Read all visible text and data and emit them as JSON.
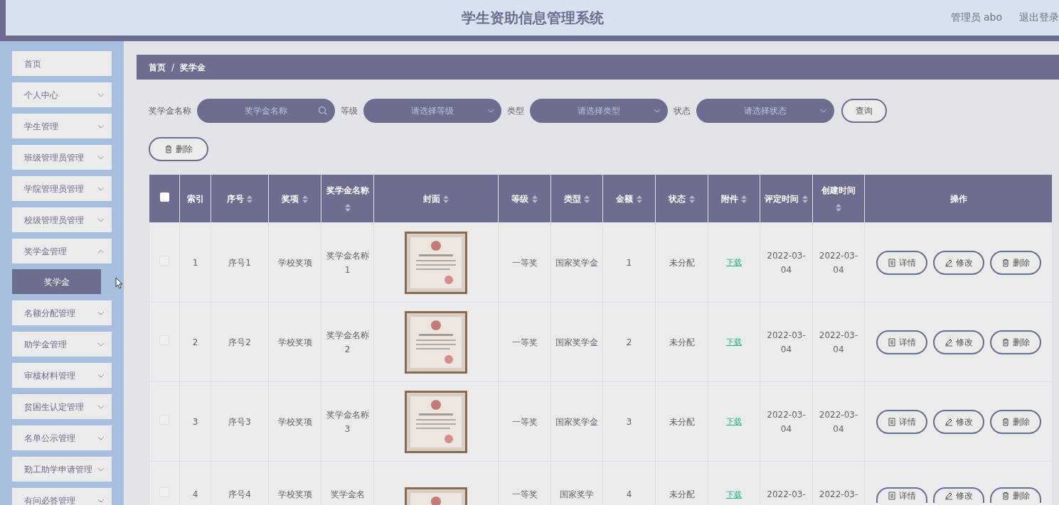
{
  "header": {
    "title": "学生资助信息管理系统",
    "user": "管理员 abo",
    "logout": "退出登录"
  },
  "sidebar": {
    "items": [
      {
        "label": "首页",
        "expandable": false
      },
      {
        "label": "个人中心",
        "expandable": true,
        "expanded": false
      },
      {
        "label": "学生管理",
        "expandable": true,
        "expanded": false
      },
      {
        "label": "班级管理员管理",
        "expandable": true,
        "expanded": false
      },
      {
        "label": "学院管理员管理",
        "expandable": true,
        "expanded": false
      },
      {
        "label": "校级管理员管理",
        "expandable": true,
        "expanded": false
      },
      {
        "label": "奖学金管理",
        "expandable": true,
        "expanded": true,
        "children": [
          {
            "label": "奖学金",
            "selected": true
          }
        ]
      },
      {
        "label": "名额分配管理",
        "expandable": true,
        "expanded": false
      },
      {
        "label": "助学金管理",
        "expandable": true,
        "expanded": false
      },
      {
        "label": "审核材料管理",
        "expandable": true,
        "expanded": false
      },
      {
        "label": "贫困生认定管理",
        "expandable": true,
        "expanded": false
      },
      {
        "label": "名单公示管理",
        "expandable": true,
        "expanded": false
      },
      {
        "label": "勤工助学申请管理",
        "expandable": true,
        "expanded": false
      },
      {
        "label": "有问必答管理",
        "expandable": true,
        "expanded": false
      }
    ]
  },
  "breadcrumb": [
    "首页",
    "/",
    "奖学金"
  ],
  "filters": [
    {
      "label": "奖学金名称",
      "kind": "search",
      "placeholder": "奖学金名称"
    },
    {
      "label": "等级",
      "kind": "select",
      "placeholder": "请选择等级"
    },
    {
      "label": "类型",
      "kind": "select",
      "placeholder": "请选择类型"
    },
    {
      "label": "状态",
      "kind": "select",
      "placeholder": "请选择状态"
    }
  ],
  "query_button": "查询",
  "delete_button": "删除",
  "table": {
    "columns": [
      {
        "kind": "checkbox",
        "checked": false
      },
      {
        "label": "索引",
        "sortable": false
      },
      {
        "label": "序号",
        "sortable": true
      },
      {
        "label": "奖项",
        "sortable": true
      },
      {
        "label": "奖学金名称",
        "sortable": true
      },
      {
        "label": "封面",
        "sortable": true
      },
      {
        "label": "等级",
        "sortable": true
      },
      {
        "label": "类型",
        "sortable": true
      },
      {
        "label": "金额",
        "sortable": true
      },
      {
        "label": "状态",
        "sortable": true
      },
      {
        "label": "附件",
        "sortable": true
      },
      {
        "label": "评定时间",
        "sortable": true
      },
      {
        "label": "创建时间",
        "sortable": true
      },
      {
        "label": "操作",
        "sortable": false
      }
    ],
    "rows": [
      {
        "checked": false,
        "index": "1",
        "number": "序号1",
        "award": "学校奖项",
        "name": "奖学金名称1",
        "cover": {
          "kind": "picture"
        },
        "level": "一等奖",
        "type": "国家奖学金",
        "amount": "1",
        "status": "未分配",
        "attachment": "下载",
        "rated": "2022-03-04",
        "created": "2022-03-04",
        "actions": [
          {
            "kind": "detail",
            "label": "详情"
          },
          {
            "kind": "edit",
            "label": "修改"
          },
          {
            "kind": "delete",
            "label": "删除"
          }
        ]
      },
      {
        "checked": false,
        "index": "2",
        "number": "序号2",
        "award": "学校奖项",
        "name": "奖学金名称2",
        "cover": {
          "kind": "picture"
        },
        "level": "一等奖",
        "type": "国家奖学金",
        "amount": "2",
        "status": "未分配",
        "attachment": "下载",
        "rated": "2022-03-04",
        "created": "2022-03-04",
        "actions": [
          {
            "kind": "detail",
            "label": "详情"
          },
          {
            "kind": "edit",
            "label": "修改"
          },
          {
            "kind": "delete",
            "label": "删除"
          }
        ]
      },
      {
        "checked": false,
        "index": "3",
        "number": "序号3",
        "award": "学校奖项",
        "name": "奖学金名称3",
        "cover": {
          "kind": "picture"
        },
        "level": "一等奖",
        "type": "国家奖学金",
        "amount": "3",
        "status": "未分配",
        "attachment": "下载",
        "rated": "2022-03-04",
        "created": "2022-03-04",
        "actions": [
          {
            "kind": "detail",
            "label": "详情"
          },
          {
            "kind": "edit",
            "label": "修改"
          },
          {
            "kind": "delete",
            "label": "删除"
          }
        ]
      },
      {
        "checked": false,
        "index": "4",
        "number": "序号4",
        "award": "学校奖项",
        "name": "奖学金名",
        "cover": {
          "kind": "picture"
        },
        "level": "一等奖",
        "type": "国家奖学",
        "amount": "4",
        "status": "未分配",
        "attachment": "下载",
        "rated": "2022-03-",
        "created": "2022-03-",
        "actions": [
          {
            "kind": "detail",
            "label": "详情"
          },
          {
            "kind": "edit",
            "label": "修改"
          },
          {
            "kind": "delete",
            "label": "删除"
          }
        ]
      }
    ]
  }
}
